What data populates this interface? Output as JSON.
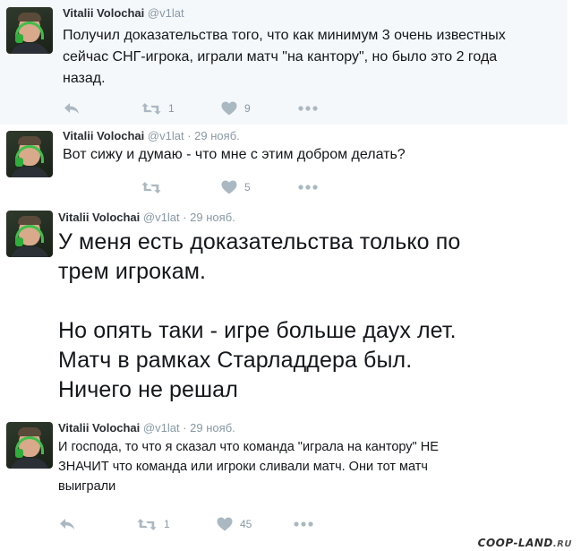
{
  "tweets": [
    {
      "name": "Vitalii Volochai",
      "handle": "@v1lat",
      "date": "",
      "lines": [
        "Получил доказательства того, что как минимум 3 очень известных",
        "сейчас СНГ-игрока, играли матч \"на кантору\", но было это 2 года",
        "назад."
      ],
      "retweets": "1",
      "likes": "9"
    },
    {
      "name": "Vitalii Volochai",
      "handle": "@v1lat",
      "date": "29 нояб.",
      "lines": [
        "Вот сижу и думаю - что мне с этим добром делать?"
      ],
      "retweets": "",
      "likes": "5"
    },
    {
      "name": "Vitalii Volochai",
      "handle": "@v1lat",
      "date": "29 нояб.",
      "lines": [
        "У меня есть доказательства только по",
        "трем игрокам.",
        "",
        "Но опять таки - игре больше даух лет.",
        "Матч в рамках Старладдера был.",
        "Ничего не решал"
      ]
    },
    {
      "name": "Vitalii Volochai",
      "handle": "@v1lat",
      "date": "29 нояб.",
      "lines": [
        "И господа, то что я сказал что команда \"играла на кантору\" НЕ",
        "ЗНАЧИТ что команда или игроки сливали матч. Они тот матч",
        "выиграли"
      ],
      "retweets": "1",
      "likes": "45"
    }
  ],
  "separator": "·",
  "icons": {
    "reply": "reply-icon",
    "retweet": "retweet-icon",
    "like": "heart-icon",
    "more": "more-icon"
  },
  "colors": {
    "icon": "#aab8c2",
    "tweet_highlight_bg": "#f5f8fa"
  },
  "watermark": {
    "text": "COOP-LAND",
    "suffix": ".RU"
  }
}
